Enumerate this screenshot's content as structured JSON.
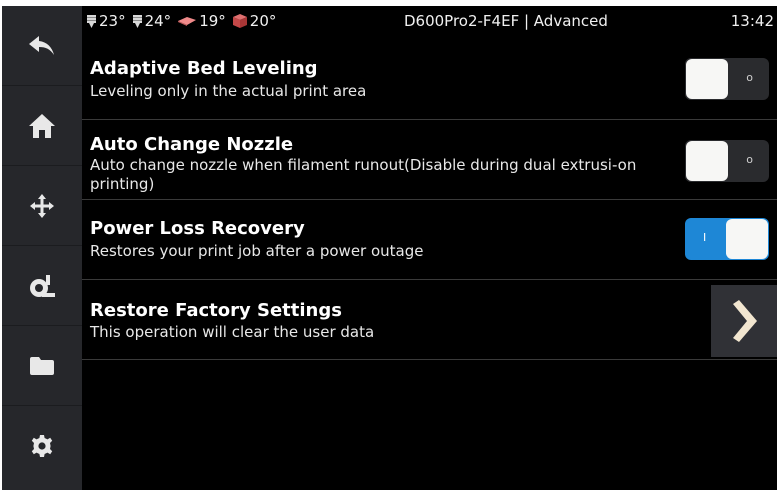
{
  "status": {
    "temps": [
      {
        "icon": "nozzle-icon",
        "value": "23°"
      },
      {
        "icon": "nozzle-icon",
        "value": "24°"
      },
      {
        "icon": "heated-bed-icon",
        "value": "19°"
      },
      {
        "icon": "chamber-cube-icon",
        "value": "20°"
      }
    ],
    "title": "D600Pro2-F4EF | Advanced",
    "time": "13:42"
  },
  "sidebar": {
    "items": [
      {
        "icon": "back-arrow-icon"
      },
      {
        "icon": "home-icon"
      },
      {
        "icon": "move-arrows-icon"
      },
      {
        "icon": "extruder-icon"
      },
      {
        "icon": "folder-icon"
      },
      {
        "icon": "gear-icon"
      }
    ]
  },
  "settings": [
    {
      "title": "Adaptive Bed Leveling",
      "desc": "Leveling only in the actual print area",
      "control": "toggle",
      "enabled": false
    },
    {
      "title": "Auto Change Nozzle",
      "desc": "Auto change nozzle when filament runout(Disable during dual extrusi-on printing)",
      "control": "toggle",
      "enabled": false
    },
    {
      "title": "Power Loss Recovery",
      "desc": "Restores your print job after a power outage",
      "control": "toggle",
      "enabled": true
    },
    {
      "title": "Restore Factory Settings",
      "desc": "This operation will clear the user data",
      "control": "chevron"
    }
  ],
  "colors": {
    "accent": "#1e87d6",
    "sidebar": "#26272b",
    "background": "#000000"
  }
}
